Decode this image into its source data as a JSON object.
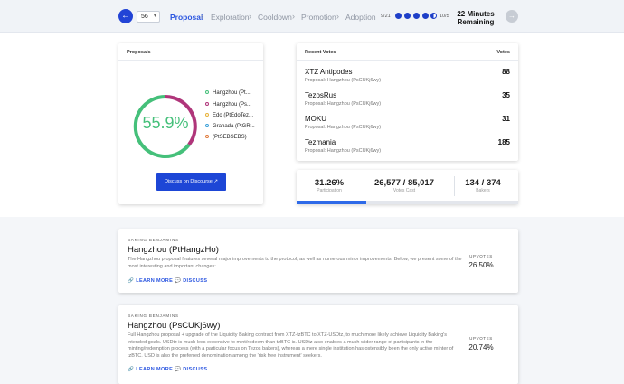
{
  "header": {
    "back_icon": "arrow-left-icon",
    "period_selected": "56",
    "stages": [
      "Proposal",
      "Exploration",
      "Cooldown",
      "Promotion",
      "Adoption"
    ],
    "active_stage": "Proposal",
    "progress_start": "9/21",
    "progress_end": "10/5",
    "progress_dots": [
      1,
      1,
      1,
      1,
      0.5
    ],
    "remaining": "22 Minutes Remaining",
    "next_icon": "arrow-right-icon"
  },
  "proposals_card": {
    "title": "Proposals",
    "percentage": "55.9%",
    "accent_color": "#45c07a",
    "legend": [
      {
        "label": "Hangzhou (Pt...",
        "color": "#45c07a"
      },
      {
        "label": "Hangzhou (Ps...",
        "color": "#b0357a"
      },
      {
        "label": "Edo (PtEdoTez...",
        "color": "#e8b23a"
      },
      {
        "label": "Granada (PtGR...",
        "color": "#3aa0d8"
      },
      {
        "label": "(PtSEBSEBS)",
        "color": "#e07a3a"
      }
    ],
    "discuss_button": "Discuss on Discourse",
    "discuss_icon": "external-link-icon"
  },
  "recent_votes": {
    "title": "Recent Votes",
    "count_header": "Votes",
    "items": [
      {
        "name": "XTZ Antipodes",
        "proposal": "Proposal: Hangzhou (PsCUKj6wy)",
        "votes": "88"
      },
      {
        "name": "TezosRus",
        "proposal": "Proposal: Hangzhou (PsCUKj6wy)",
        "votes": "35"
      },
      {
        "name": "MOKU",
        "proposal": "Proposal: Hangzhou (PsCUKj6wy)",
        "votes": "31"
      },
      {
        "name": "Tezmania",
        "proposal": "Proposal: Hangzhou (PsCUKj6wy)",
        "votes": "185"
      }
    ]
  },
  "stats": {
    "participation_value": "31.26%",
    "participation_label": "Participation",
    "votes_cast_value": "26,577 / 85,017",
    "votes_cast_label": "Votes Cast",
    "bakers_value": "134 / 374",
    "bakers_label": "Bakers",
    "participation_fraction": 0.3126
  },
  "feed": [
    {
      "author": "BAKING BENJAMINS",
      "title": "Hangzhou (PtHangzHo)",
      "body": "The Hangzhou proposal features several major improvements to the protocol, as well as numerous minor improvements. Below, we present some of the most interesting and important changes:",
      "learn_more": "LEARN MORE",
      "discuss": "DISCUSS",
      "upvotes_label": "UPVOTES",
      "upvotes_value": "26.50%"
    },
    {
      "author": "BAKING BENJAMINS",
      "title": "Hangzhou (PsCUKj6wy)",
      "body": "Full Hangzhou proposal + upgrade of the Liquidity Baking contract from XTZ-tzBTC to XTZ-USDtz, to much more likely achieve Liquidity Baking's intended goals. USDtz is much less expensive to mint/redeem than tzBTC is. USDtz also enables a much wider range of participants in the minting/redemption process (with a particular focus on Tezos bakers), whereas a mere single institution has ostensibly been the only active minter of tzBTC. USD is also the preferred denomination among the 'risk free instrument' seekers.",
      "learn_more": "LEARN MORE",
      "discuss": "DISCUSS",
      "upvotes_label": "UPVOTES",
      "upvotes_value": "20.74%"
    }
  ]
}
